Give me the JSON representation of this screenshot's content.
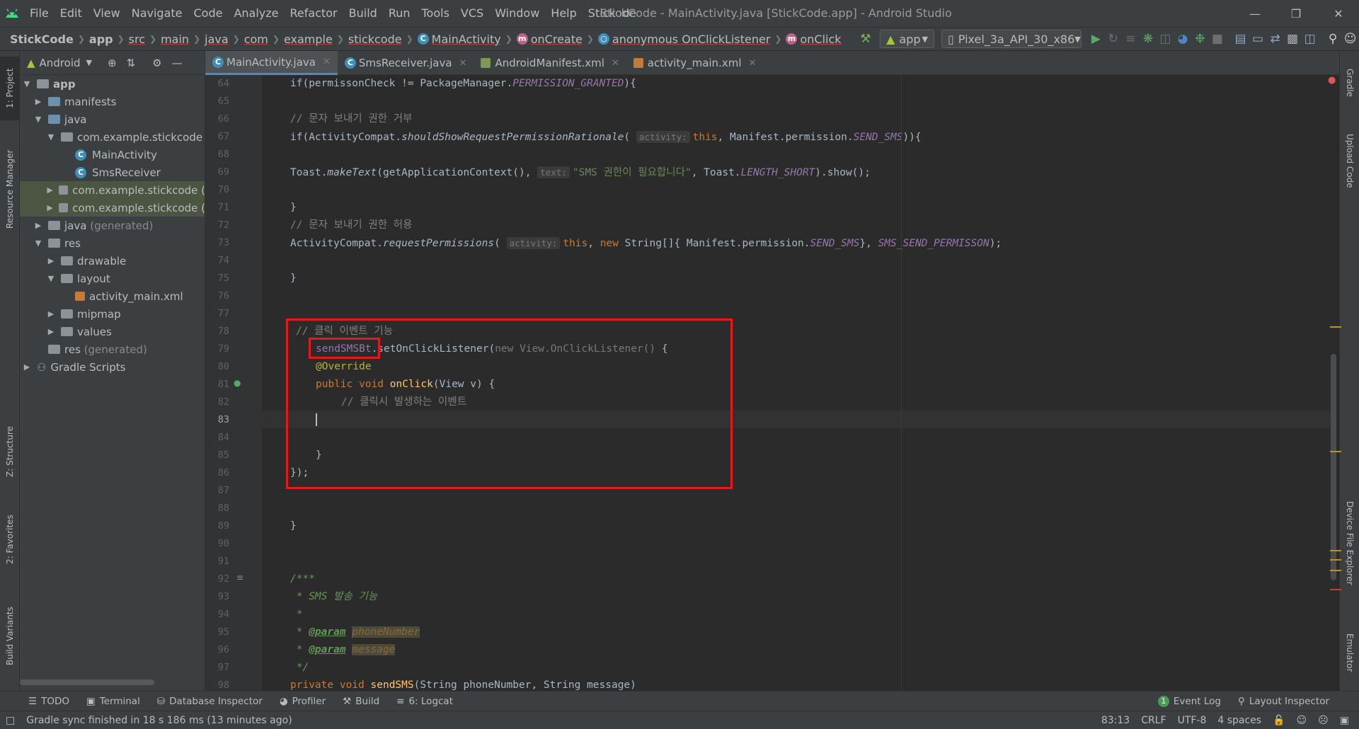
{
  "menubar": {
    "items": [
      "File",
      "Edit",
      "View",
      "Navigate",
      "Code",
      "Analyze",
      "Refactor",
      "Build",
      "Run",
      "Tools",
      "VCS",
      "Window",
      "Help",
      "Stickode"
    ],
    "window_title": "StickCode - MainActivity.java [StickCode.app] - Android Studio"
  },
  "breadcrumbs": {
    "project": "StickCode",
    "items": [
      "app",
      "src",
      "main",
      "java",
      "com",
      "example",
      "stickcode",
      "MainActivity",
      "onCreate",
      "anonymous OnClickListener",
      "onClick"
    ]
  },
  "toolbar": {
    "run_config": "app",
    "device": "Pixel_3a_API_30_x86"
  },
  "left_tool_tabs": [
    "1: Project",
    "Resource Manager",
    "Z: Structure",
    "2: Favorites",
    "Build Variants"
  ],
  "right_tool_tabs": [
    "Gradle",
    "Upload Code",
    "Device File Explorer",
    "Emulator"
  ],
  "project_panel": {
    "view_mode": "Android",
    "tree": [
      {
        "label": "app",
        "type": "module",
        "indent": 0,
        "expanded": true
      },
      {
        "label": "manifests",
        "type": "folder",
        "indent": 1,
        "expanded": false
      },
      {
        "label": "java",
        "type": "folder",
        "indent": 1,
        "expanded": true
      },
      {
        "label": "com.example.stickcode",
        "type": "package",
        "indent": 2,
        "expanded": true
      },
      {
        "label": "MainActivity",
        "type": "class",
        "indent": 3
      },
      {
        "label": "SmsReceiver",
        "type": "class",
        "indent": 3
      },
      {
        "label": "com.example.stickcode (",
        "type": "package",
        "indent": 2,
        "expanded": false,
        "selected": true
      },
      {
        "label": "com.example.stickcode (",
        "type": "package",
        "indent": 2,
        "expanded": false,
        "selected": true
      },
      {
        "label": "java",
        "suffix": "(generated)",
        "type": "folder",
        "indent": 1,
        "expanded": false
      },
      {
        "label": "res",
        "type": "folder",
        "indent": 1,
        "expanded": true
      },
      {
        "label": "drawable",
        "type": "folder",
        "indent": 2,
        "expanded": false
      },
      {
        "label": "layout",
        "type": "folder",
        "indent": 2,
        "expanded": true
      },
      {
        "label": "activity_main.xml",
        "type": "xml",
        "indent": 3
      },
      {
        "label": "mipmap",
        "type": "folder",
        "indent": 2,
        "expanded": false
      },
      {
        "label": "values",
        "type": "folder",
        "indent": 2,
        "expanded": false
      },
      {
        "label": "res",
        "suffix": "(generated)",
        "type": "folder",
        "indent": 1
      },
      {
        "label": "Gradle Scripts",
        "type": "gradle",
        "indent": 0,
        "expanded": false
      }
    ]
  },
  "editor_tabs": [
    {
      "label": "MainActivity.java",
      "active": true,
      "kind": "class"
    },
    {
      "label": "SmsReceiver.java",
      "active": false,
      "kind": "class"
    },
    {
      "label": "AndroidManifest.xml",
      "active": false,
      "kind": "manifest"
    },
    {
      "label": "activity_main.xml",
      "active": false,
      "kind": "xml"
    }
  ],
  "editor": {
    "current_line": 83,
    "line_numbers": [
      64,
      65,
      66,
      67,
      68,
      69,
      70,
      71,
      72,
      73,
      74,
      75,
      76,
      77,
      78,
      79,
      80,
      81,
      82,
      83,
      84,
      85,
      86,
      87,
      88,
      89,
      90,
      91,
      92,
      93,
      94,
      95,
      96,
      97,
      98
    ],
    "code": {
      "l64": "if(permissonCheck != PackageManager.",
      "l64b": "PERMISSION_GRANTED",
      "l64c": "){",
      "l66": "// 문자 보내기 권한 거부",
      "l67a": "if(ActivityCompat.",
      "l67b": "shouldShowRequestPermissionRationale",
      "l67c": "(",
      "l67hint": "activity:",
      "l67d": "this",
      "l67e": ", Manifest.permission.",
      "l67f": "SEND_SMS",
      "l67g": ")){",
      "l69a": "Toast.",
      "l69b": "makeText",
      "l69c": "(getApplicationContext(), ",
      "l69hint": "text:",
      "l69d": "\"SMS 권한이 필요합니다\"",
      "l69e": ", Toast.",
      "l69f": "LENGTH_SHORT",
      "l69g": ").show();",
      "l71": "}",
      "l72": "// 문자 보내기 권한 허용",
      "l73a": "ActivityCompat.",
      "l73b": "requestPermissions",
      "l73c": "(",
      "l73hint": "activity:",
      "l73d": "this",
      "l73e": ", ",
      "l73f": "new",
      "l73g": " String[]{ Manifest.permission.",
      "l73h": "SEND_SMS",
      "l73i": "}, ",
      "l73j": "SMS_SEND_PERMISSON",
      "l73k": ");",
      "l75": "}",
      "l78": "// 클릭 이벤트 기능",
      "l79a": "sendSMSBt",
      "l79b": ".setOnClickListener(",
      "l79c": "new View.OnClickListener() ",
      "l79d": "{",
      "l80": "@Override",
      "l81a": "public void ",
      "l81b": "onClick",
      "l81c": "(View v) {",
      "l82": "// 클릭시 발생하는 이벤트",
      "l85": "}",
      "l86": "});",
      "l89": "}",
      "l92": "/***",
      "l93": " * SMS 발송 기능",
      "l94": " *",
      "l95a": " * ",
      "l95b": "@param",
      "l95c": "phoneNumber",
      "l96a": " * ",
      "l96b": "@param",
      "l96c": "message",
      "l97": " */",
      "l98a": "private void ",
      "l98b": "sendSMS",
      "l98c": "(String phoneNumber, String message)"
    }
  },
  "bottom_tools": {
    "left": [
      "TODO",
      "Terminal",
      "Database Inspector",
      "Profiler",
      "Build",
      "6: Logcat"
    ],
    "right": [
      "Event Log",
      "Layout Inspector"
    ],
    "event_log_count": "1"
  },
  "status_bar": {
    "message": "Gradle sync finished in 18 s 186 ms (13 minutes ago)",
    "position": "83:13",
    "line_sep": "CRLF",
    "encoding": "UTF-8",
    "indent": "4 spaces"
  },
  "colors": {
    "accent": "#4a88c7",
    "highlight_box": "#e21a1a",
    "android_green": "#a4c639"
  }
}
